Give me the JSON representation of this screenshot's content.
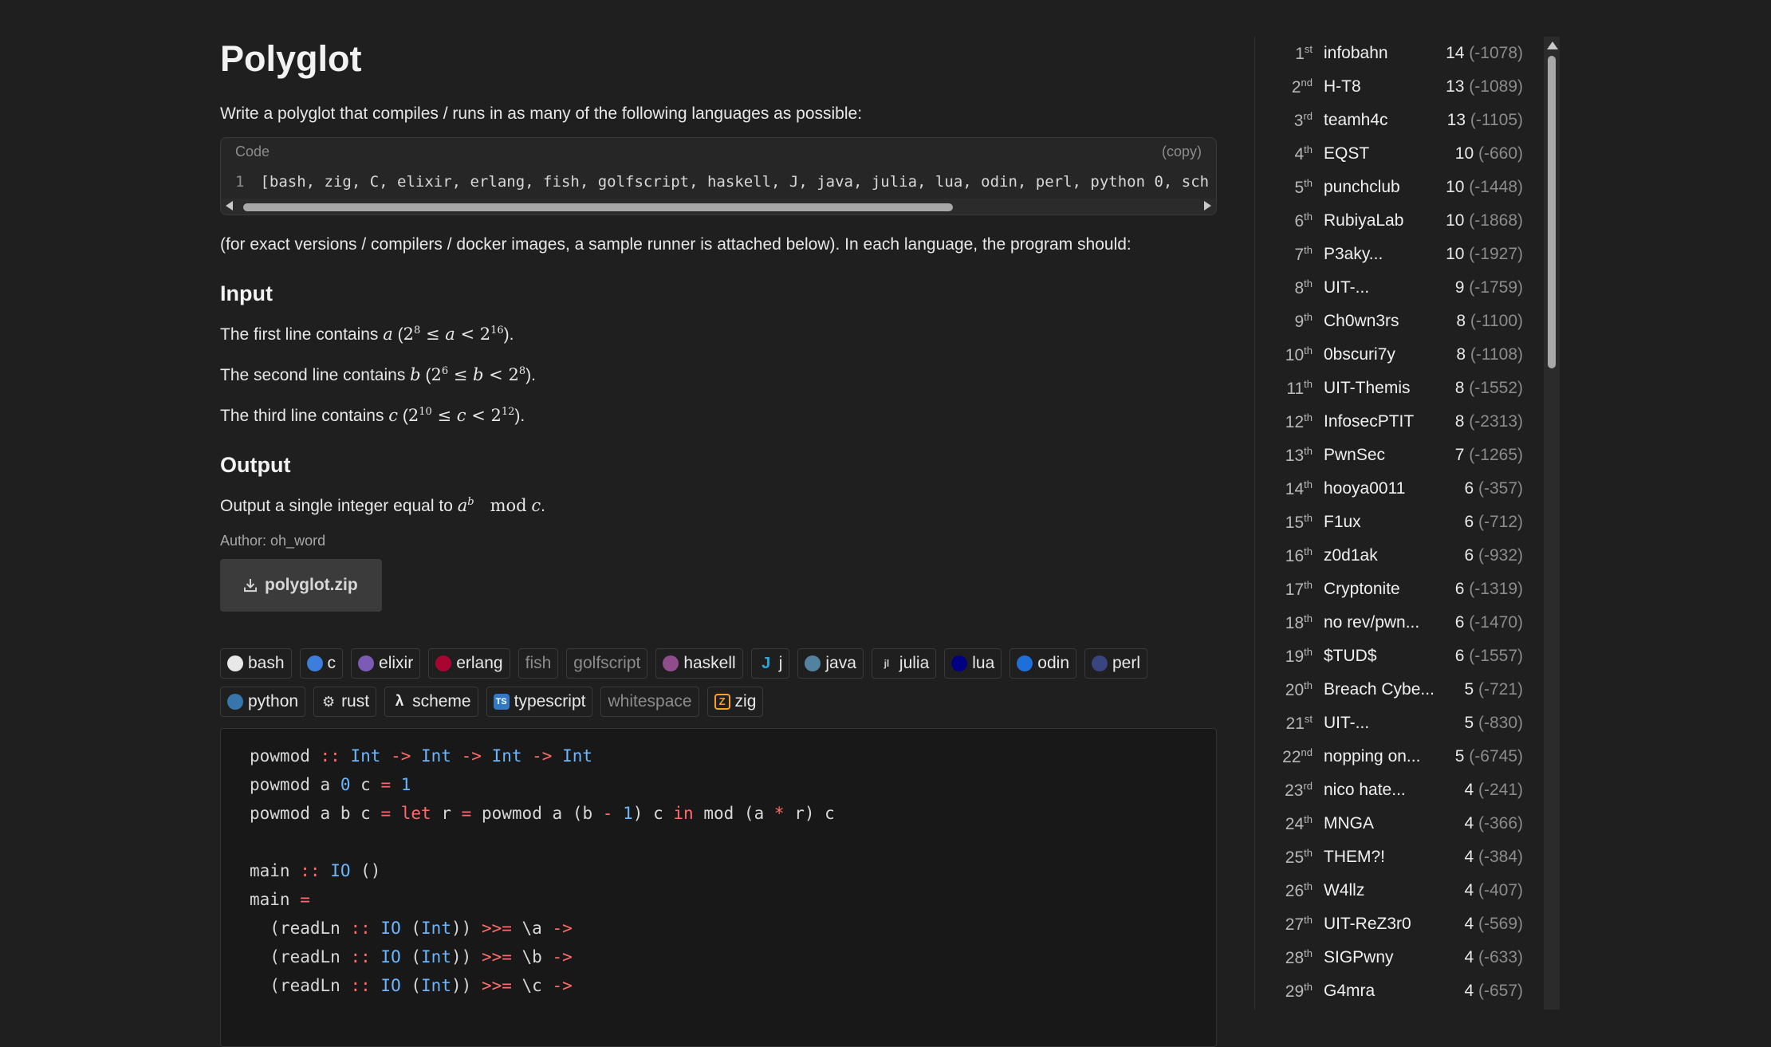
{
  "title": "Polyglot",
  "intro": "Write a polyglot that compiles / runs in as many of the following languages as possible:",
  "code_header": {
    "label": "Code",
    "copy": "(copy)"
  },
  "code_line": {
    "num": "1",
    "text": "[bash, zig, C, elixir, erlang, fish, golfscript, haskell, J, java, julia, lua, odin, perl, python 0, sch"
  },
  "note": "(for exact versions / compilers / docker images, a sample runner is attached below). In each language, the program should:",
  "input_heading": "Input",
  "input_lines": [
    {
      "pre": "The first line contains ",
      "var": "a",
      "lo": "2",
      "lo_exp": "8",
      "rel1": " ≤ ",
      "rel2": " < ",
      "hi": "2",
      "hi_exp": "16",
      "post": "."
    },
    {
      "pre": "The second line contains ",
      "var": "b",
      "lo": "2",
      "lo_exp": "6",
      "rel1": " ≤ ",
      "rel2": " < ",
      "hi": "2",
      "hi_exp": "8",
      "post": "."
    },
    {
      "pre": "The third line contains ",
      "var": "c",
      "lo": "2",
      "lo_exp": "10",
      "rel1": " ≤ ",
      "rel2": " < ",
      "hi": "2",
      "hi_exp": "12",
      "post": "."
    }
  ],
  "output_heading": "Output",
  "output_line": {
    "pre": "Output a single integer equal to ",
    "base": "a",
    "exp": "b",
    "mod": "mod",
    "var": "c",
    "post": "."
  },
  "author": "Author: oh_word",
  "download": {
    "label": "polyglot.zip",
    "icon": "download-icon"
  },
  "languages": [
    {
      "name": "bash",
      "icon": "bash-icon",
      "color": "#e8e8e8",
      "dim": false
    },
    {
      "name": "c",
      "icon": "c-icon",
      "color": "#3d7ddb",
      "dim": false
    },
    {
      "name": "elixir",
      "icon": "elixir-icon",
      "color": "#7b5bb6",
      "dim": false
    },
    {
      "name": "erlang",
      "icon": "erlang-icon",
      "color": "#a90533",
      "dim": false
    },
    {
      "name": "fish",
      "icon": "",
      "color": "",
      "dim": true
    },
    {
      "name": "golfscript",
      "icon": "",
      "color": "",
      "dim": true
    },
    {
      "name": "haskell",
      "icon": "haskell-icon",
      "color": "#8f4e8b",
      "dim": false
    },
    {
      "name": "j",
      "icon": "j-icon",
      "color": "#2fa5d8",
      "dim": false
    },
    {
      "name": "java",
      "icon": "java-icon",
      "color": "#5382a1",
      "dim": false
    },
    {
      "name": "julia",
      "icon": "julia-icon",
      "color": "#cccccc",
      "dim": false
    },
    {
      "name": "lua",
      "icon": "lua-icon",
      "color": "#000080",
      "dim": false
    },
    {
      "name": "odin",
      "icon": "odin-icon",
      "color": "#1e6fd9",
      "dim": false
    },
    {
      "name": "perl",
      "icon": "perl-icon",
      "color": "#39457e",
      "dim": false
    },
    {
      "name": "python",
      "icon": "python-icon",
      "color": "#3776ab",
      "dim": false
    },
    {
      "name": "rust",
      "icon": "rust-icon",
      "color": "#dddddd",
      "dim": false
    },
    {
      "name": "scheme",
      "icon": "lambda-icon",
      "color": "",
      "dim": false
    },
    {
      "name": "typescript",
      "icon": "typescript-icon",
      "color": "#3178c6",
      "dim": false
    },
    {
      "name": "whitespace",
      "icon": "",
      "color": "",
      "dim": true
    },
    {
      "name": "zig",
      "icon": "zig-icon",
      "color": "#f7a41d",
      "dim": false
    }
  ],
  "code_sample": [
    "powmod :: Int -> Int -> Int -> Int",
    "powmod a 0 c = 1",
    "powmod a b c = let r = powmod a (b - 1) c in mod (a * r) c",
    "",
    "main :: IO ()",
    "main =",
    "  (readLn :: IO (Int)) >>= \\a ->",
    "  (readLn :: IO (Int)) >>= \\b ->",
    "  (readLn :: IO (Int)) >>= \\c ->"
  ],
  "leaderboard": [
    {
      "rank": "1",
      "suffix": "st",
      "team": "infobahn",
      "score": "14",
      "penalty": "(-1078)"
    },
    {
      "rank": "2",
      "suffix": "nd",
      "team": "H-T8",
      "score": "13",
      "penalty": "(-1089)"
    },
    {
      "rank": "3",
      "suffix": "rd",
      "team": "teamh4c",
      "score": "13",
      "penalty": "(-1105)"
    },
    {
      "rank": "4",
      "suffix": "th",
      "team": "EQST",
      "score": "10",
      "penalty": "(-660)"
    },
    {
      "rank": "5",
      "suffix": "th",
      "team": "punchclub",
      "score": "10",
      "penalty": "(-1448)"
    },
    {
      "rank": "6",
      "suffix": "th",
      "team": "RubiyaLab",
      "score": "10",
      "penalty": "(-1868)"
    },
    {
      "rank": "7",
      "suffix": "th",
      "team": "P3aky...",
      "score": "10",
      "penalty": "(-1927)"
    },
    {
      "rank": "8",
      "suffix": "th",
      "team": "UIT-...",
      "score": "9",
      "penalty": "(-1759)"
    },
    {
      "rank": "9",
      "suffix": "th",
      "team": "Ch0wn3rs",
      "score": "8",
      "penalty": "(-1100)"
    },
    {
      "rank": "10",
      "suffix": "th",
      "team": "0bscuri7y",
      "score": "8",
      "penalty": "(-1108)"
    },
    {
      "rank": "11",
      "suffix": "th",
      "team": "UIT-Themis",
      "score": "8",
      "penalty": "(-1552)"
    },
    {
      "rank": "12",
      "suffix": "th",
      "team": "InfosecPTIT",
      "score": "8",
      "penalty": "(-2313)"
    },
    {
      "rank": "13",
      "suffix": "th",
      "team": "PwnSec",
      "score": "7",
      "penalty": "(-1265)"
    },
    {
      "rank": "14",
      "suffix": "th",
      "team": "hooya0011",
      "score": "6",
      "penalty": "(-357)"
    },
    {
      "rank": "15",
      "suffix": "th",
      "team": "F1ux",
      "score": "6",
      "penalty": "(-712)"
    },
    {
      "rank": "16",
      "suffix": "th",
      "team": "z0d1ak",
      "score": "6",
      "penalty": "(-932)"
    },
    {
      "rank": "17",
      "suffix": "th",
      "team": "Cryptonite",
      "score": "6",
      "penalty": "(-1319)"
    },
    {
      "rank": "18",
      "suffix": "th",
      "team": "no rev/pwn...",
      "score": "6",
      "penalty": "(-1470)"
    },
    {
      "rank": "19",
      "suffix": "th",
      "team": "$TUD$",
      "score": "6",
      "penalty": "(-1557)"
    },
    {
      "rank": "20",
      "suffix": "th",
      "team": "Breach Cybe...",
      "score": "5",
      "penalty": "(-721)"
    },
    {
      "rank": "21",
      "suffix": "st",
      "team": "UIT-...",
      "score": "5",
      "penalty": "(-830)"
    },
    {
      "rank": "22",
      "suffix": "nd",
      "team": "nopping on...",
      "score": "5",
      "penalty": "(-6745)"
    },
    {
      "rank": "23",
      "suffix": "rd",
      "team": "nico hate...",
      "score": "4",
      "penalty": "(-241)"
    },
    {
      "rank": "24",
      "suffix": "th",
      "team": "MNGA",
      "score": "4",
      "penalty": "(-366)"
    },
    {
      "rank": "25",
      "suffix": "th",
      "team": "THEM?!",
      "score": "4",
      "penalty": "(-384)"
    },
    {
      "rank": "26",
      "suffix": "th",
      "team": "W4llz",
      "score": "4",
      "penalty": "(-407)"
    },
    {
      "rank": "27",
      "suffix": "th",
      "team": "UIT-ReZ3r0",
      "score": "4",
      "penalty": "(-569)"
    },
    {
      "rank": "28",
      "suffix": "th",
      "team": "SIGPwny",
      "score": "4",
      "penalty": "(-633)"
    },
    {
      "rank": "29",
      "suffix": "th",
      "team": "G4mra",
      "score": "4",
      "penalty": "(-657)"
    }
  ]
}
